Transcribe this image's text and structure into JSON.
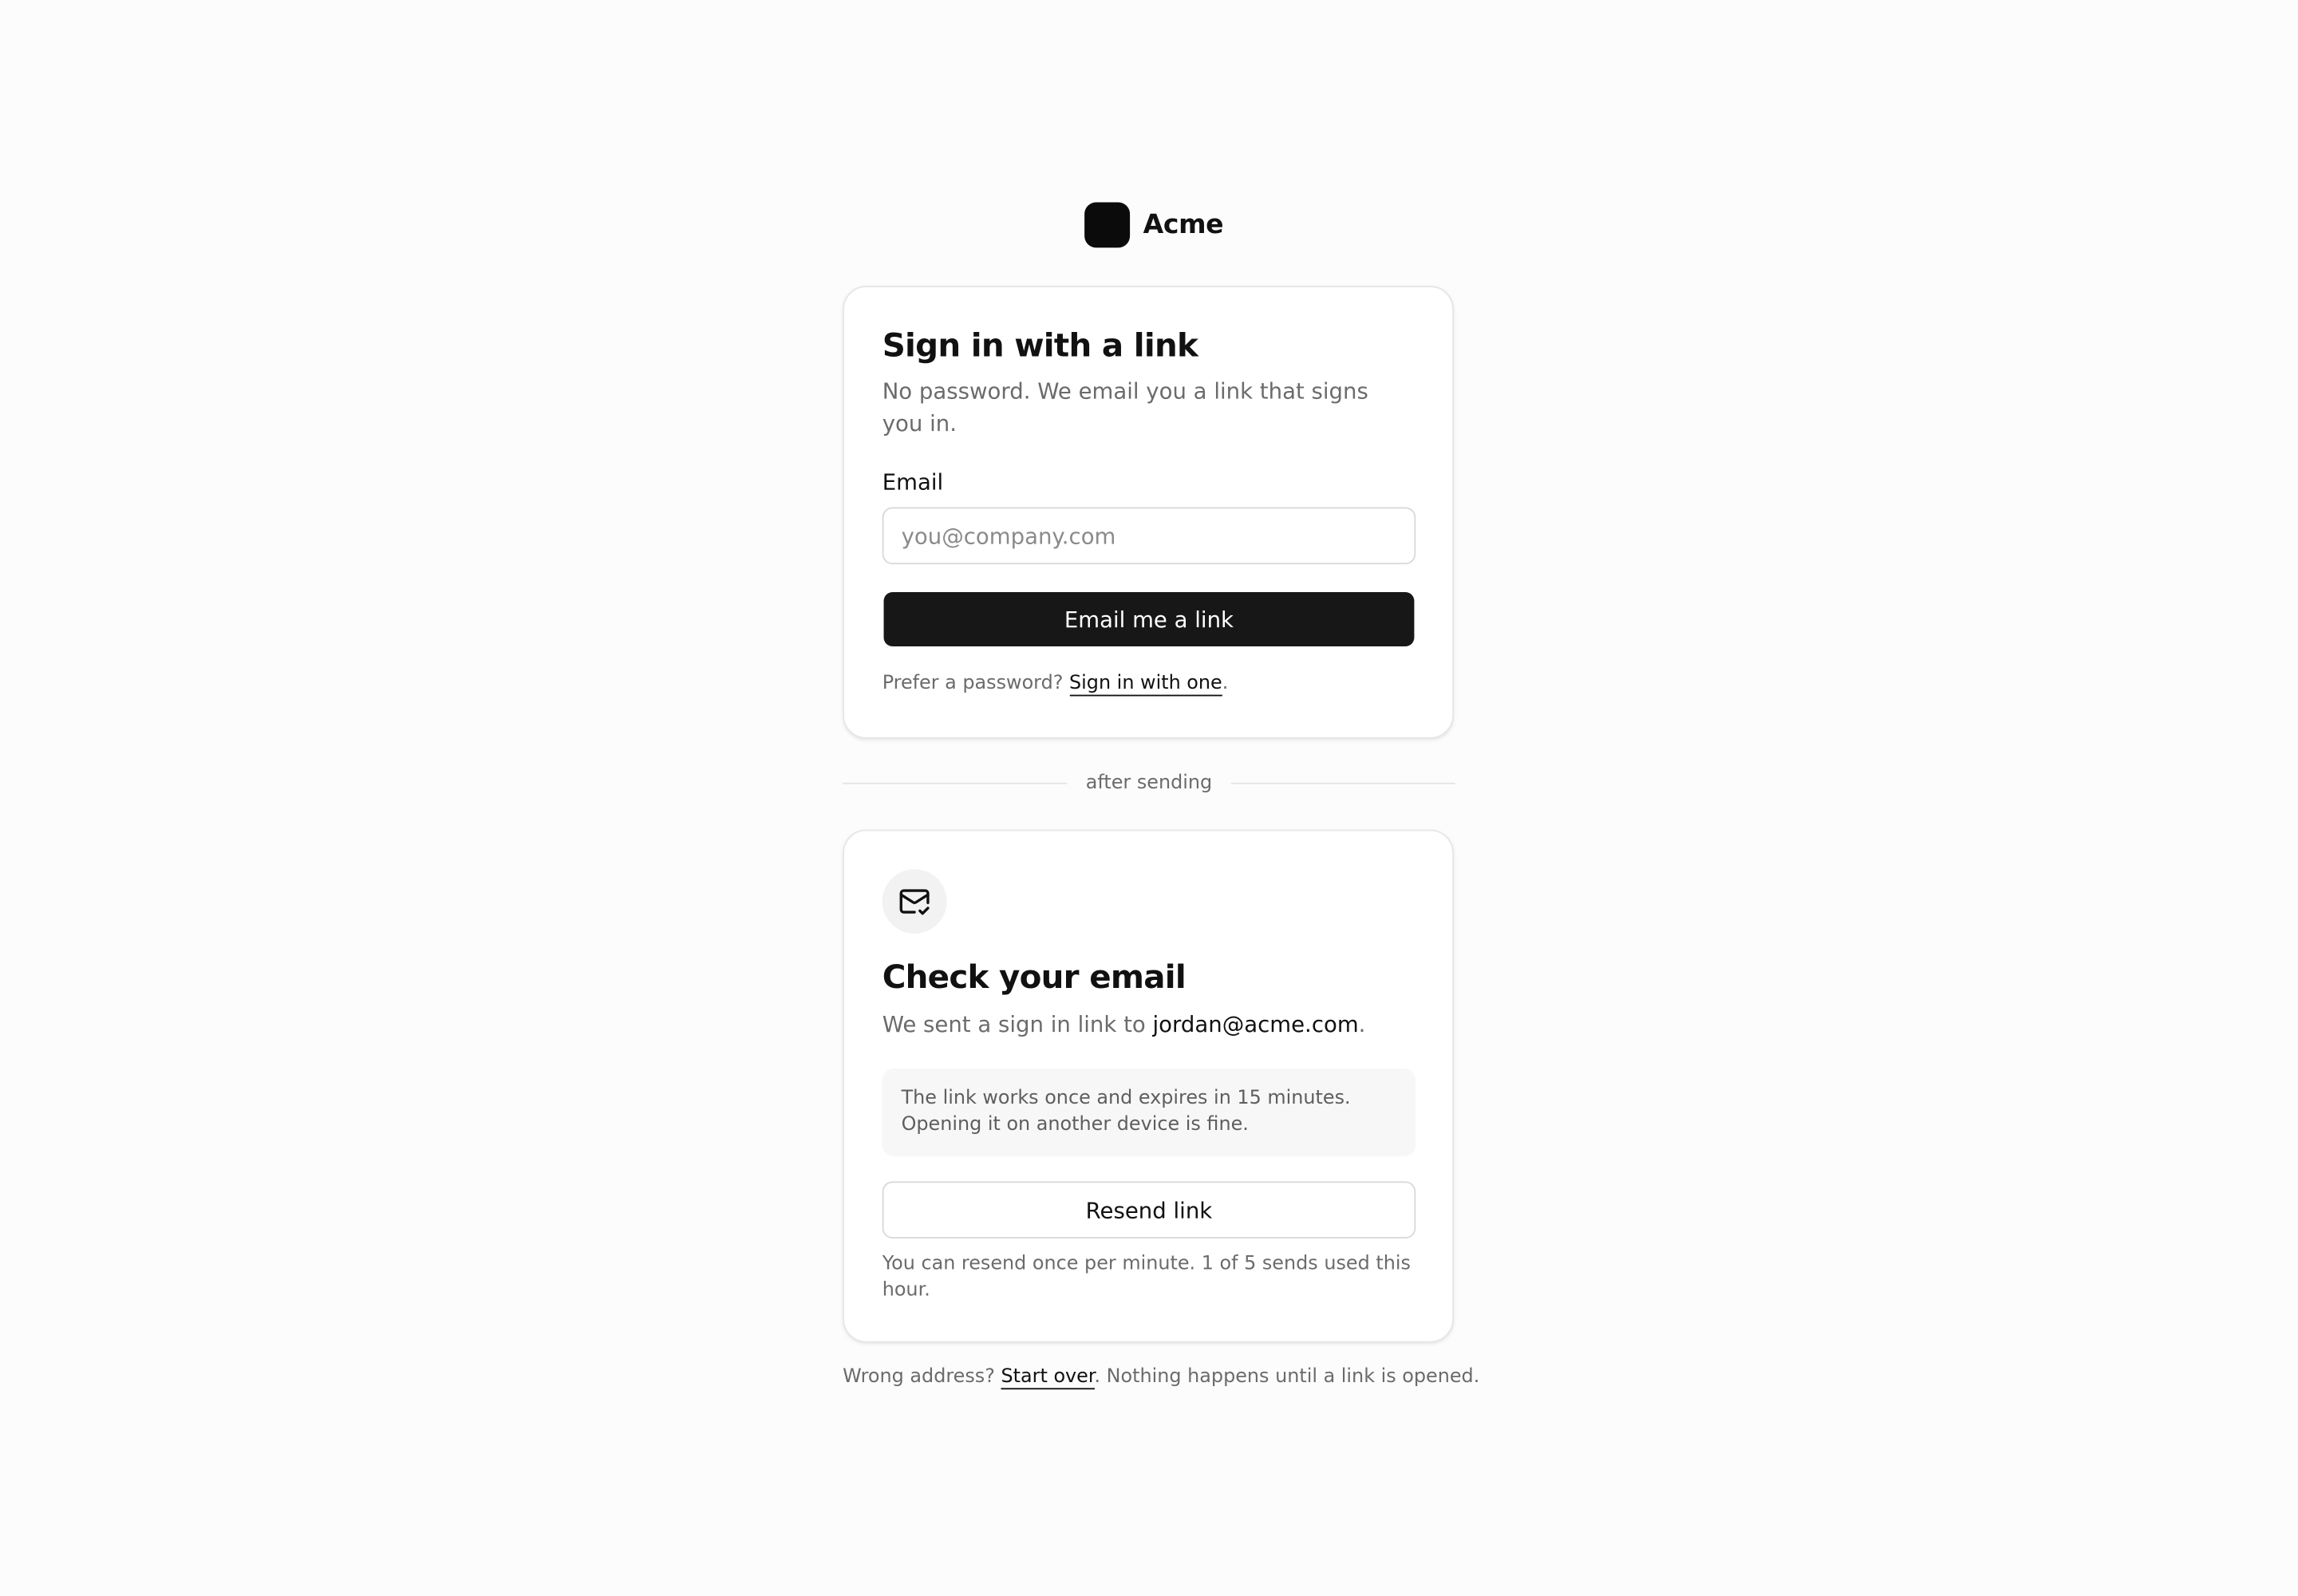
{
  "brand": {
    "name": "Acme"
  },
  "signin": {
    "title": "Sign in with a link",
    "subtitle": "No password. We email you a link that signs you in.",
    "email_label": "Email",
    "email_placeholder": "you@company.com",
    "email_value": "",
    "submit_label": "Email me a link",
    "password_prompt": "Prefer a password?",
    "password_link": "Sign in with one",
    "password_suffix": "."
  },
  "divider": {
    "label": "after sending"
  },
  "sent": {
    "icon": "mail-check-icon",
    "title": "Check your email",
    "message_prefix": "We sent a sign in link to",
    "email": "jordan@acme.com",
    "message_suffix": ".",
    "note": "The link works once and expires in 15 minutes. Opening it on another device is fine.",
    "resend_label": "Resend link",
    "resend_note": "You can resend once per minute. 1 of 5 sends used this hour."
  },
  "footer": {
    "prefix": "Wrong address?",
    "link": "Start over",
    "suffix": ". Nothing happens until a link is opened."
  },
  "colors": {
    "background": "#fcfcfc",
    "primary_button": "#171717",
    "muted_text": "#6b6b6b",
    "border": "#d9d9d9"
  }
}
